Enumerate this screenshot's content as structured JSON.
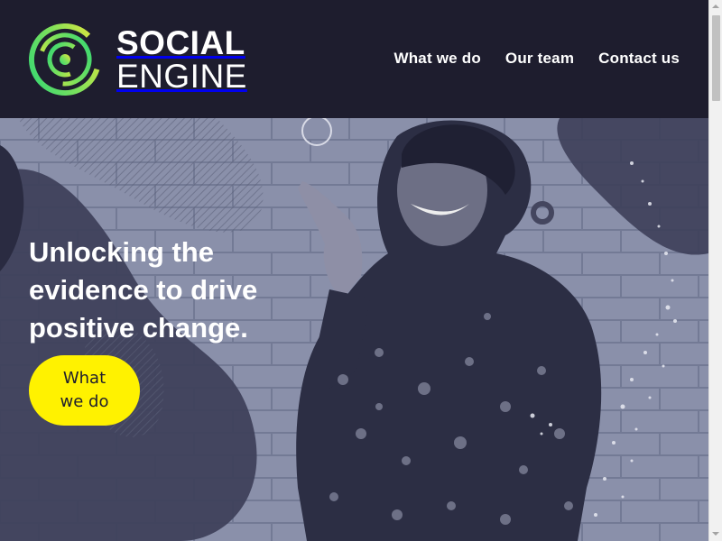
{
  "brand": {
    "name_line1": "SOCIAL",
    "name_line2": "ENGINE",
    "colors": {
      "dark": "#1e1d2e",
      "accent_yellow": "#fff200",
      "logo_green": "#2fd675",
      "logo_yellow": "#f1e838"
    }
  },
  "nav": {
    "items": [
      {
        "label": "What we do"
      },
      {
        "label": "Our team"
      },
      {
        "label": "Contact us"
      }
    ]
  },
  "hero": {
    "headline": "Unlocking the evidence to drive positive change.",
    "cta_label": "What we do",
    "image": "woman-smiling-pointing-photo"
  },
  "icons": [
    "logo-rings-icon",
    "chevron-up-icon",
    "chevron-down-icon"
  ]
}
